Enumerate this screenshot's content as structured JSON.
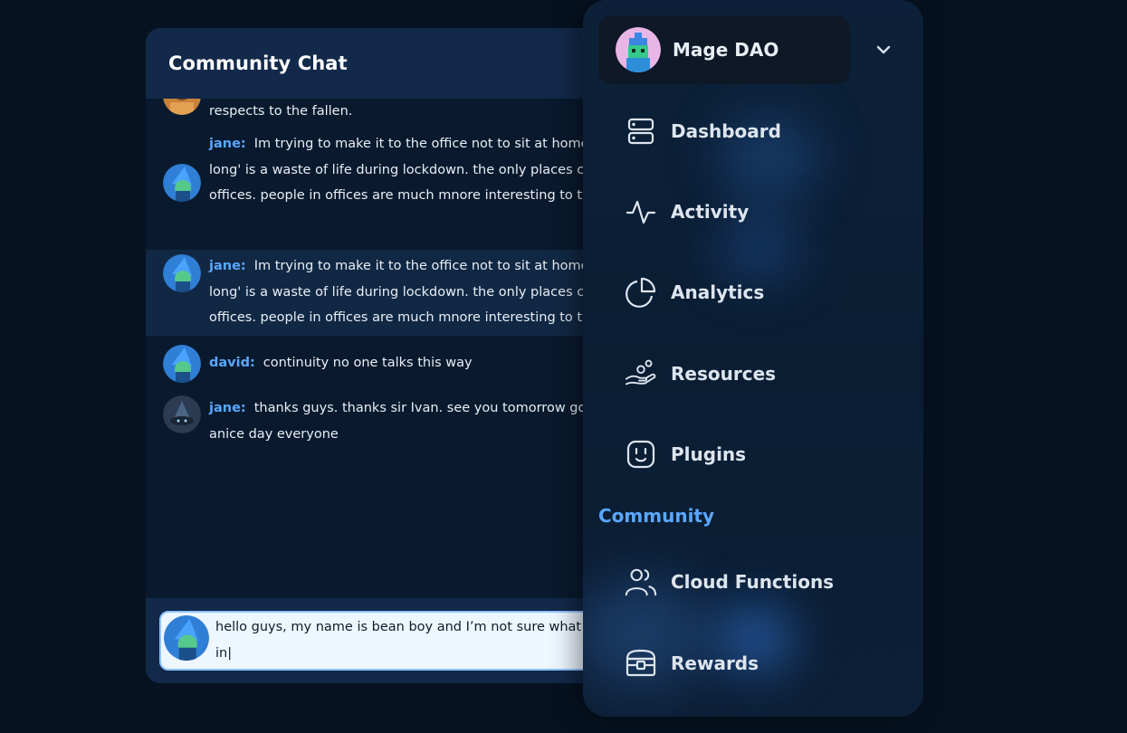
{
  "chat": {
    "title": "Community Chat",
    "messages": [
      {
        "author": "",
        "text": "respects to the fallen."
      },
      {
        "author": "jane:",
        "lines": [
          "Im trying to make it to the office not to sit at home",
          "long' is a waste of life during lockdown. the only places c",
          "offices. people in offices are much mnore interesting to t"
        ]
      },
      {
        "author": "jane:",
        "lines": [
          "Im trying to make it to the office not to sit at home",
          "long' is a waste of life during lockdown. the only places c",
          "offices. people in offices are much mnore interesting to t"
        ]
      },
      {
        "author": "david:",
        "text": "continuity no one talks this way"
      },
      {
        "author": "jane:",
        "lines": [
          "thanks guys. thanks sir Ivan. see you tomorrow go",
          "anice day everyone"
        ]
      }
    ],
    "composer": {
      "text": "hello guys, my name is bean boy and I’m not sure what I\nin|"
    }
  },
  "sidebar": {
    "org_name": "Mage DAO",
    "nav": [
      {
        "label": "Dashboard",
        "icon": "server-icon"
      },
      {
        "label": "Activity",
        "icon": "activity-icon"
      },
      {
        "label": "Analytics",
        "icon": "pie-chart-icon"
      },
      {
        "label": "Resources",
        "icon": "hand-coins-icon"
      },
      {
        "label": "Plugins",
        "icon": "plug-icon"
      }
    ],
    "section_title": "Community",
    "community_nav": [
      {
        "label": "Cloud Functions",
        "icon": "users-icon"
      },
      {
        "label": "Rewards",
        "icon": "treasure-chest-icon"
      }
    ]
  },
  "colors": {
    "background": "#061221",
    "accent": "#5aa7ff",
    "panel": "#091a2e",
    "header": "#12294a"
  }
}
